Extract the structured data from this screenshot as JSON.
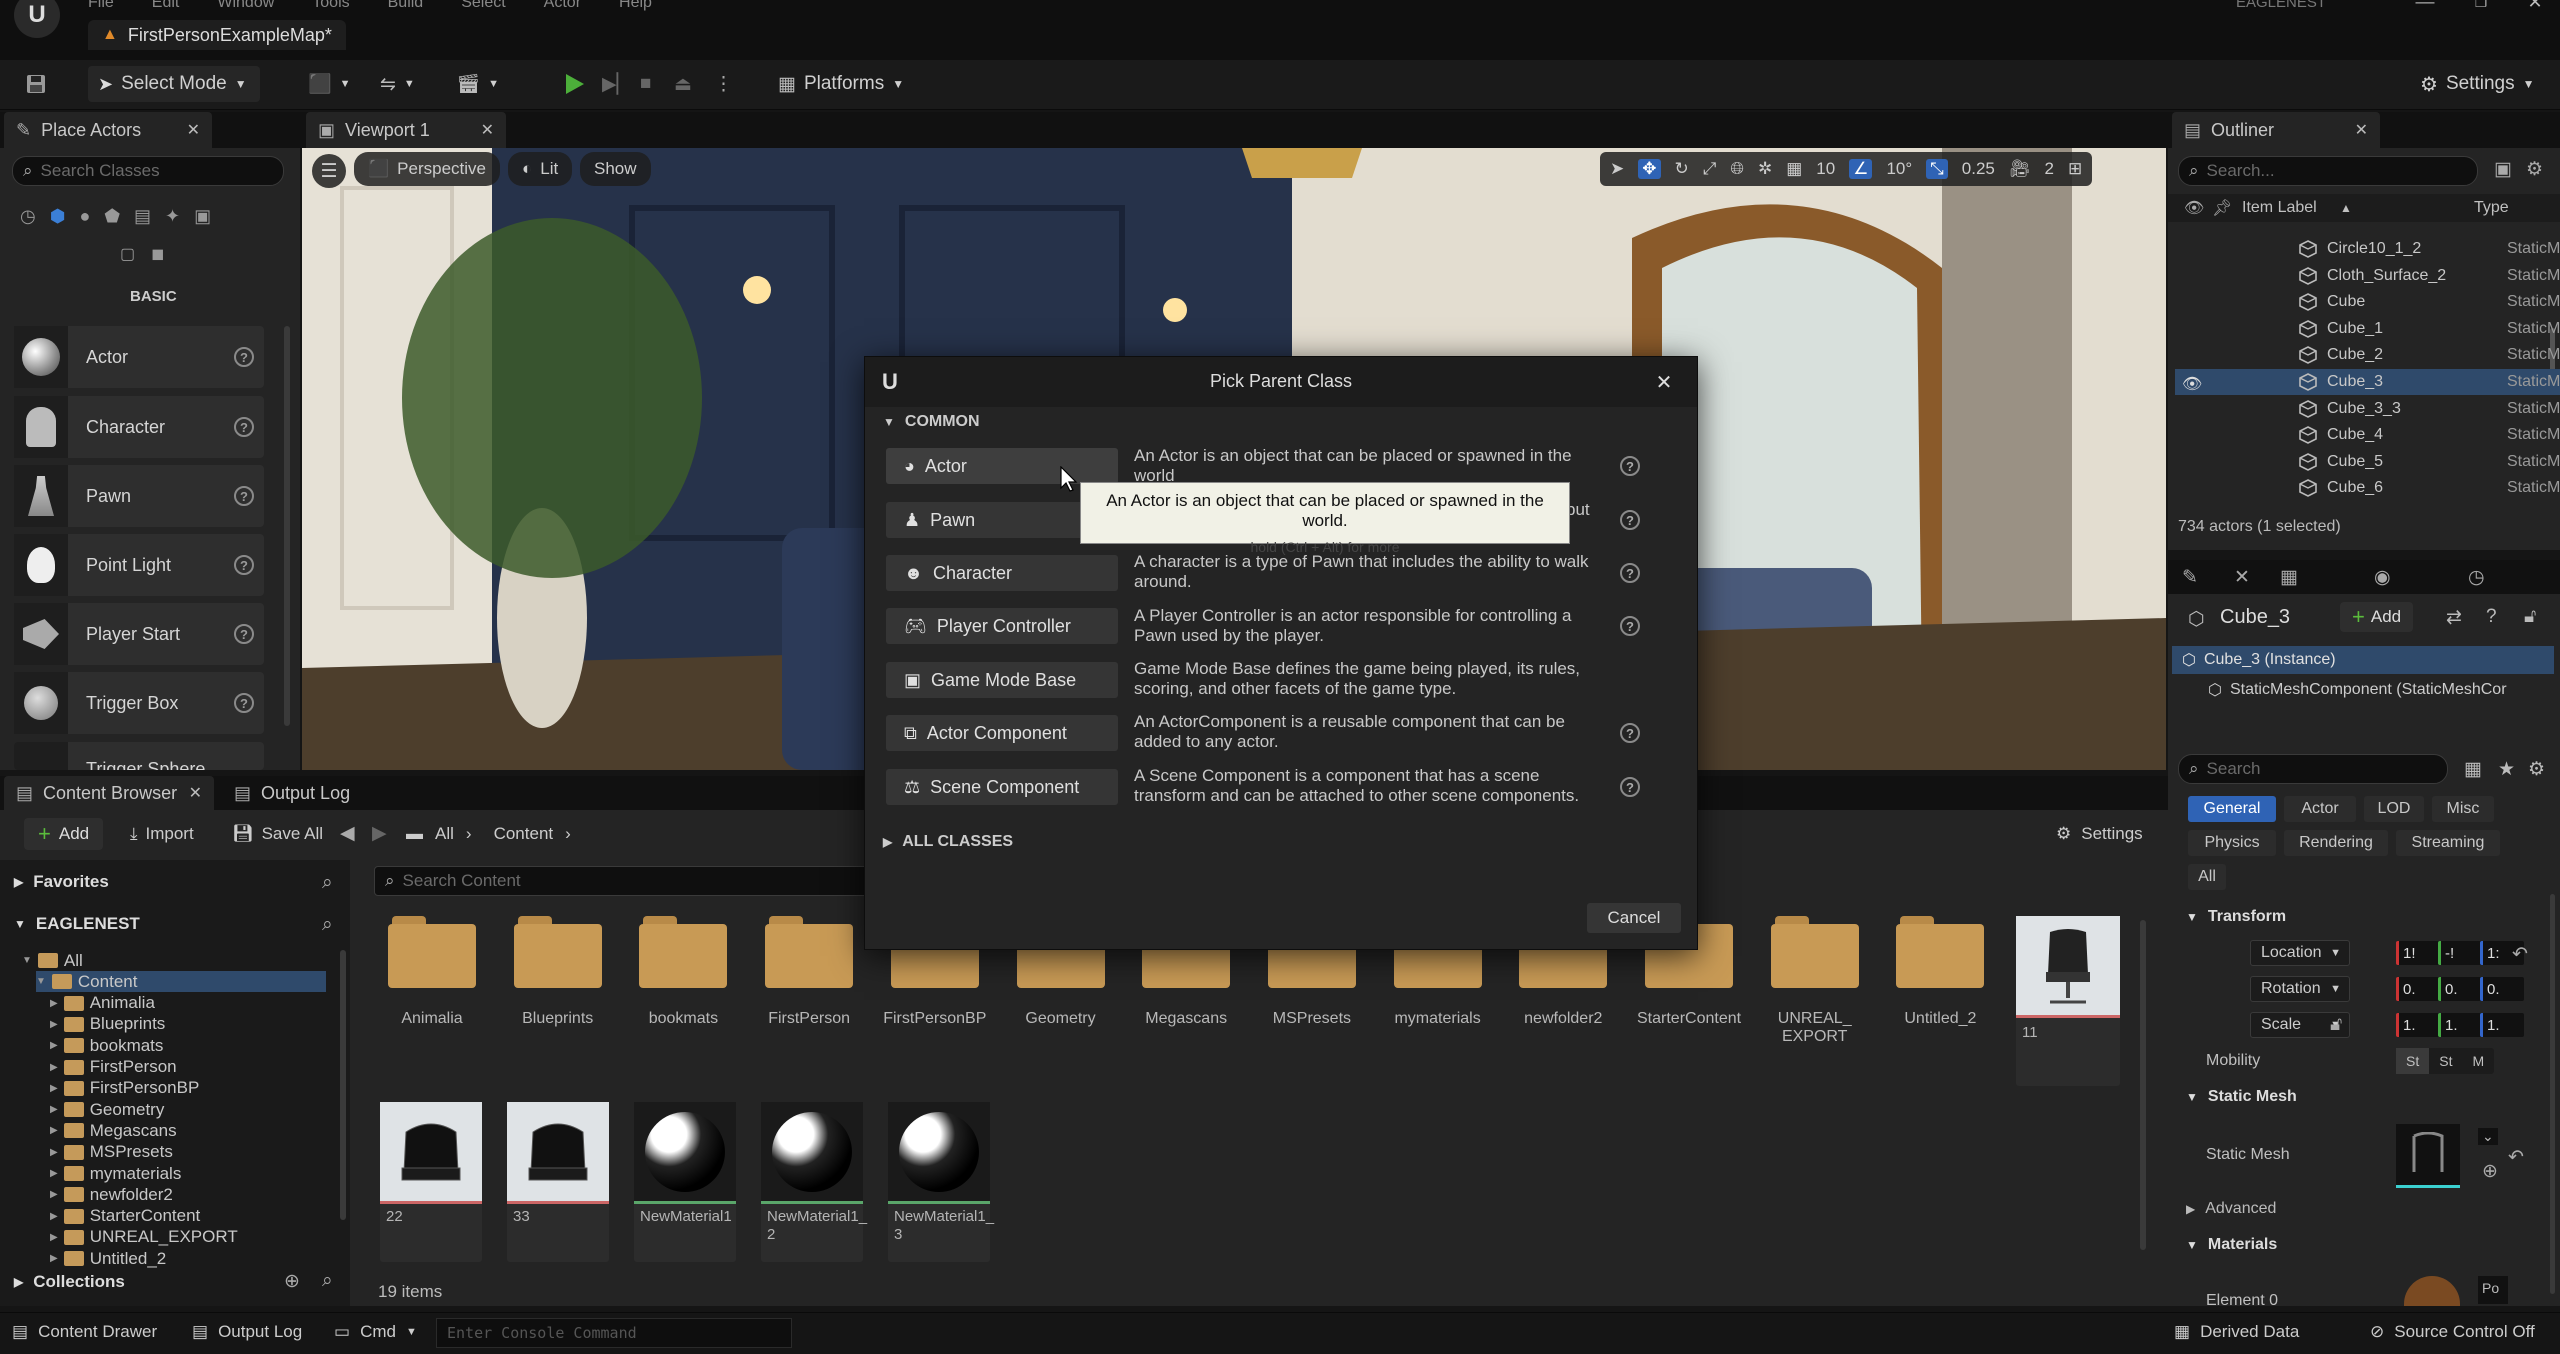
{
  "titlebar": {
    "map_name": "FirstPersonExampleMap*",
    "project": "EAGLENEST",
    "menu": [
      "File",
      "Edit",
      "Window",
      "Tools",
      "Build",
      "Select",
      "Actor",
      "Help"
    ]
  },
  "toolbar": {
    "select_mode": "Select Mode",
    "platforms": "Platforms",
    "settings": "Settings"
  },
  "place_actors": {
    "tab": "Place Actors",
    "search_placeholder": "Search Classes",
    "category": "BASIC",
    "items": [
      {
        "label": "Actor",
        "icon": "sphere-icon"
      },
      {
        "label": "Character",
        "icon": "character-icon"
      },
      {
        "label": "Pawn",
        "icon": "pawn-icon"
      },
      {
        "label": "Point Light",
        "icon": "lightbulb-icon"
      },
      {
        "label": "Player Start",
        "icon": "player-start-icon"
      },
      {
        "label": "Trigger Box",
        "icon": "trigger-box-icon"
      },
      {
        "label": "Trigger Sphere",
        "icon": "trigger-sphere-icon"
      }
    ]
  },
  "viewport": {
    "tab": "Viewport 1",
    "perspective": "Perspective",
    "lit": "Lit",
    "show": "Show",
    "grid_size": "10",
    "rot_snap": "10°",
    "scale_snap": "0.25",
    "camera_speed": "2"
  },
  "outliner": {
    "tab": "Outliner",
    "search_placeholder": "Search...",
    "col_label": "Item Label",
    "col_type": "Type",
    "rows": [
      {
        "name": "Circle10_1_2",
        "type": "StaticMes"
      },
      {
        "name": "Cloth_Surface_2",
        "type": "StaticMes"
      },
      {
        "name": "Cube",
        "type": "StaticMes"
      },
      {
        "name": "Cube_1",
        "type": "StaticMes"
      },
      {
        "name": "Cube_2",
        "type": "StaticMes"
      },
      {
        "name": "Cube_3",
        "type": "StaticMes"
      },
      {
        "name": "Cube_3_3",
        "type": "StaticMes"
      },
      {
        "name": "Cube_4",
        "type": "StaticMes"
      },
      {
        "name": "Cube_5",
        "type": "StaticMes"
      },
      {
        "name": "Cube_6",
        "type": "StaticMes"
      }
    ],
    "count": "734 actors (1 selected)"
  },
  "details": {
    "object_name": "Cube_3",
    "add": "Add",
    "instance": "Cube_3 (Instance)",
    "component": "StaticMeshComponent (StaticMeshCor",
    "search_placeholder": "Search",
    "tabs": [
      "General",
      "Actor",
      "LOD",
      "Misc",
      "Physics",
      "Rendering",
      "Streaming",
      "All"
    ],
    "transform": "Transform",
    "location": "Location",
    "rotation": "Rotation",
    "scale": "Scale",
    "location_vals": [
      "1!",
      "-!",
      "1:"
    ],
    "rotation_vals": [
      "0.",
      "0.",
      "0."
    ],
    "scale_vals": [
      "1.",
      "1.",
      "1."
    ],
    "mobility": "Mobility",
    "mobility_opts": [
      "St",
      "St",
      "M"
    ],
    "static_mesh_section": "Static Mesh",
    "static_mesh": "Static Mesh",
    "advanced": "Advanced",
    "materials": "Materials",
    "element0": "Element 0",
    "element0_value": "Po"
  },
  "content_browser": {
    "tab": "Content Browser",
    "output_tab": "Output Log",
    "add": "Add",
    "import": "Import",
    "save_all": "Save All",
    "crumb_all": "All",
    "crumb_content": "Content",
    "settings": "Settings",
    "favorites": "Favorites",
    "project": "EAGLENEST",
    "search_placeholder": "Search Content",
    "tree": [
      "All",
      "Content",
      "Animalia",
      "Blueprints",
      "bookmats",
      "FirstPerson",
      "FirstPersonBP",
      "Geometry",
      "Megascans",
      "MSPresets",
      "mymaterials",
      "newfolder2",
      "StarterContent",
      "UNREAL_EXPORT",
      "Untitled_2"
    ],
    "folders": [
      "Animalia",
      "Blueprints",
      "bookmats",
      "FirstPerson",
      "FirstPersonBP",
      "Geometry",
      "Megascans",
      "MSPresets",
      "mymaterials",
      "newfolder2",
      "StarterContent",
      "UNREAL_ EXPORT",
      "Untitled_2"
    ],
    "assets": [
      "11",
      "22",
      "33",
      "NewMaterial1",
      "NewMaterial1_ 2",
      "NewMaterial1_ 3"
    ],
    "collections": "Collections",
    "items_count": "19 items"
  },
  "statusbar": {
    "content_drawer": "Content Drawer",
    "output_log": "Output Log",
    "cmd": "Cmd",
    "console_placeholder": "Enter Console Command",
    "derived_data": "Derived Data",
    "source_control": "Source Control Off"
  },
  "dialog": {
    "title": "Pick Parent Class",
    "common": "COMMON",
    "all_classes": "ALL CLASSES",
    "cancel": "Cancel",
    "classes": [
      {
        "label": "Actor",
        "desc": "An Actor is an object that can be placed or spawned in the world."
      },
      {
        "label": "Pawn",
        "desc": "A Pawn is an actor that can be 'possessed' and receive input from a controller."
      },
      {
        "label": "Character",
        "desc": "A character is a type of Pawn that includes the ability to walk around."
      },
      {
        "label": "Player Controller",
        "desc": "A Player Controller is an actor responsible for controlling a Pawn used by the player."
      },
      {
        "label": "Game Mode Base",
        "desc": "Game Mode Base defines the game being played, its rules, scoring, and other facets of the game type."
      },
      {
        "label": "Actor Component",
        "desc": "An ActorComponent is a reusable component that can be added to any actor."
      },
      {
        "label": "Scene Component",
        "desc": "A Scene Component is a component that has a scene transform and can be attached to other scene components."
      }
    ],
    "actor_desc_visible": "An Actor is an object that can be placed or spawned in the world",
    "pawn_desc_tail": "put",
    "tooltip": "An Actor is an object that can be placed or spawned in the world.",
    "tooltip_hint": "hold (Ctrl + Alt) for more"
  }
}
